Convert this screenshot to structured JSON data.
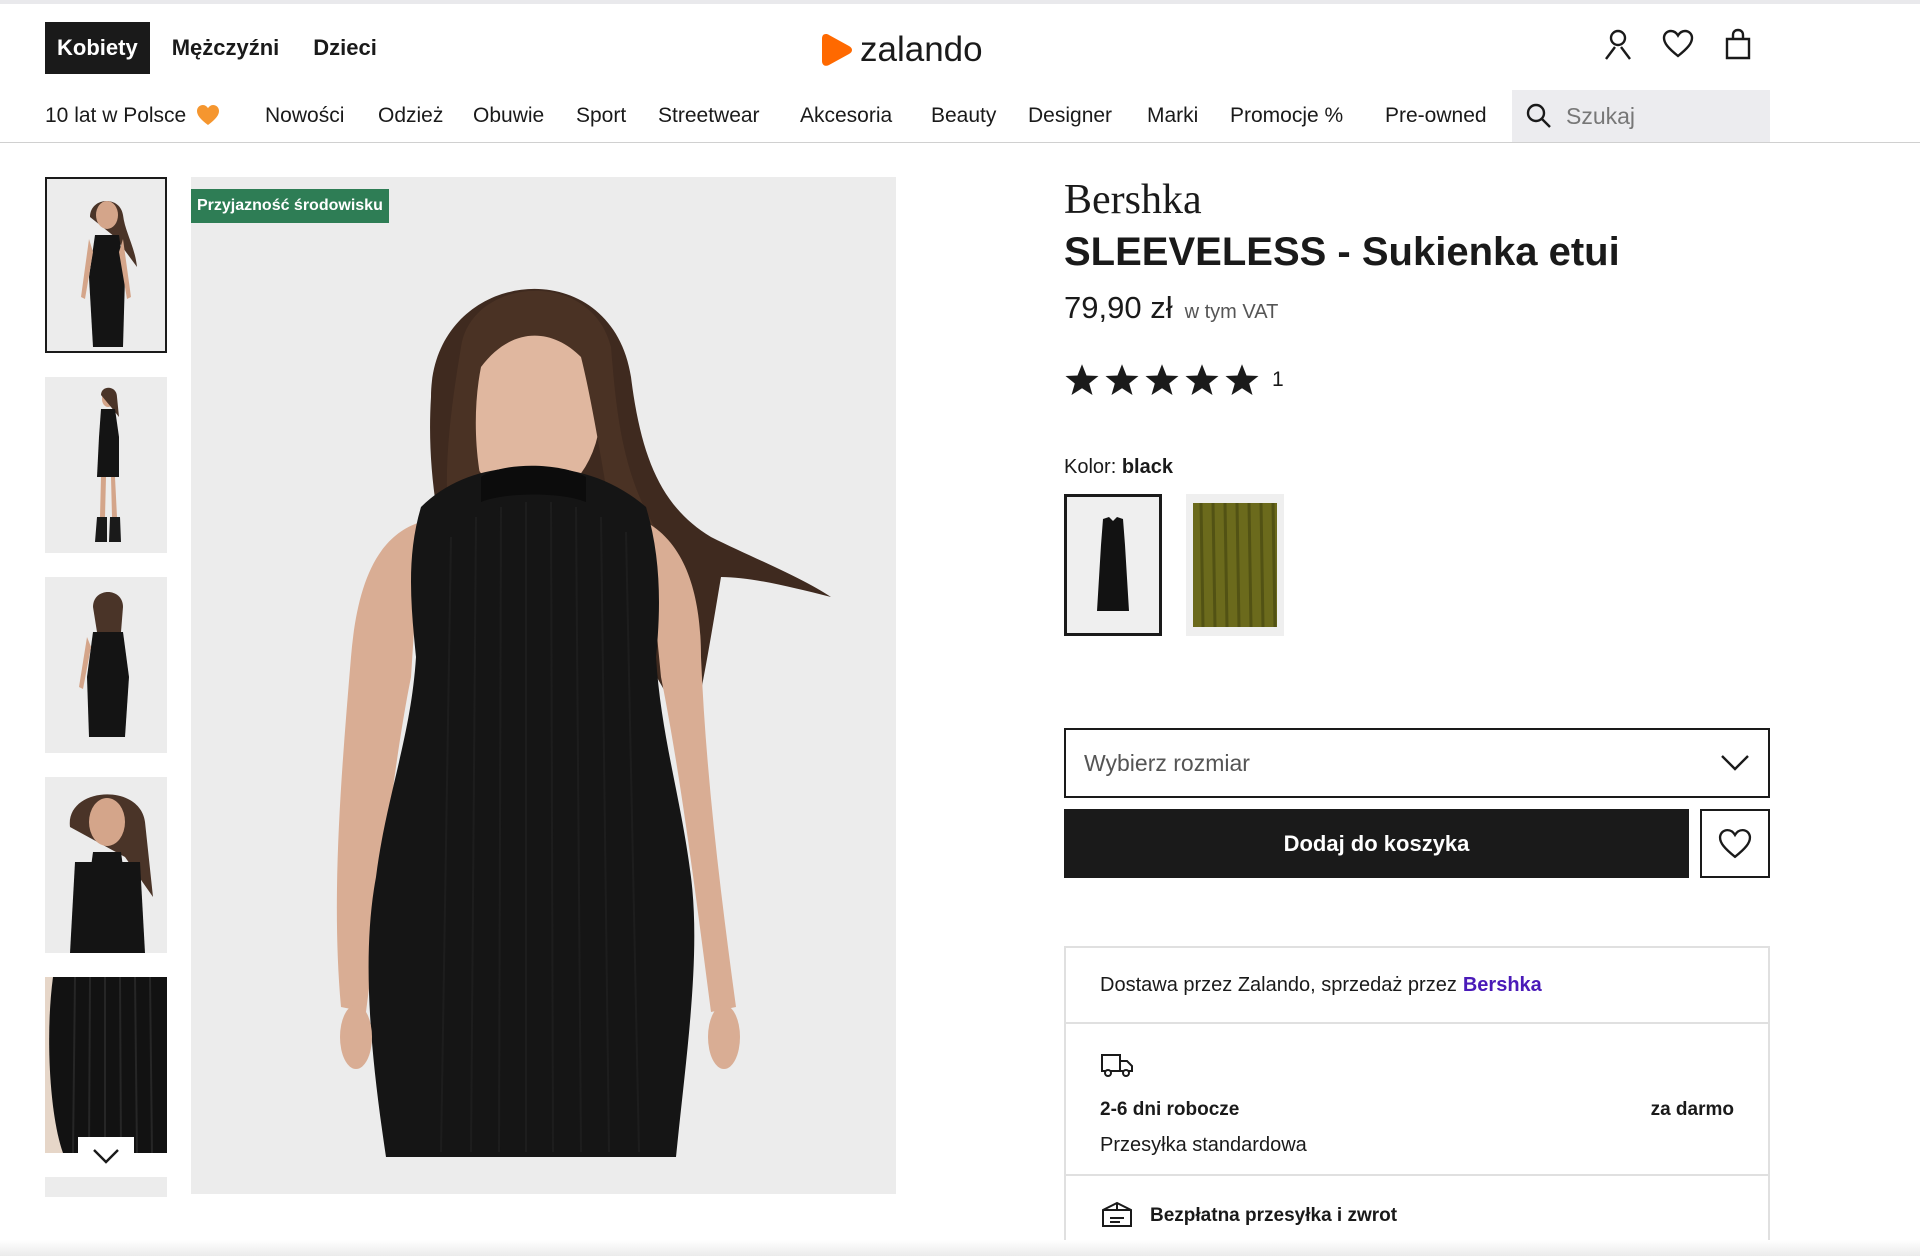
{
  "header": {
    "gender_tabs": [
      {
        "label": "Kobiety",
        "active": true
      },
      {
        "label": "Mężczyźni",
        "active": false
      },
      {
        "label": "Dzieci",
        "active": false
      }
    ],
    "logo_text": "zalando",
    "brand_color": "#ff6900",
    "icons": [
      "user-icon",
      "wishlist-heart-icon",
      "shopping-bag-icon"
    ]
  },
  "nav": {
    "promo_label": "10 lat w Polsce",
    "items": [
      "Nowości",
      "Odzież",
      "Obuwie",
      "Sport",
      "Streetwear",
      "Akcesoria",
      "Beauty",
      "Designer",
      "Marki",
      "Promocje %",
      "Pre-owned"
    ]
  },
  "search": {
    "placeholder": "Szukaj"
  },
  "gallery": {
    "badge": "Przyjazność środowisku",
    "badge_color": "#2e7d55"
  },
  "product": {
    "brand": "Bershka",
    "title": "SLEEVELESS - Sukienka etui",
    "price": "79,90 zł",
    "vat_note": "w tym VAT",
    "rating_stars": 5,
    "rating_count": "1",
    "color_label": "Kolor:",
    "color_value": "black",
    "color_swatches": [
      {
        "name": "black",
        "active": true
      },
      {
        "name": "olive",
        "active": false
      }
    ],
    "size_placeholder": "Wybierz rozmiar",
    "add_to_cart": "Dodaj do koszyka"
  },
  "delivery": {
    "seller_text": "Dostawa przez Zalando, sprzedaż przez",
    "seller_name": "Bershka",
    "days": "2-6 dni robocze",
    "cost": "za darmo",
    "method": "Przesyłka standardowa",
    "returns": "Bezpłatna przesyłka i zwrot"
  }
}
